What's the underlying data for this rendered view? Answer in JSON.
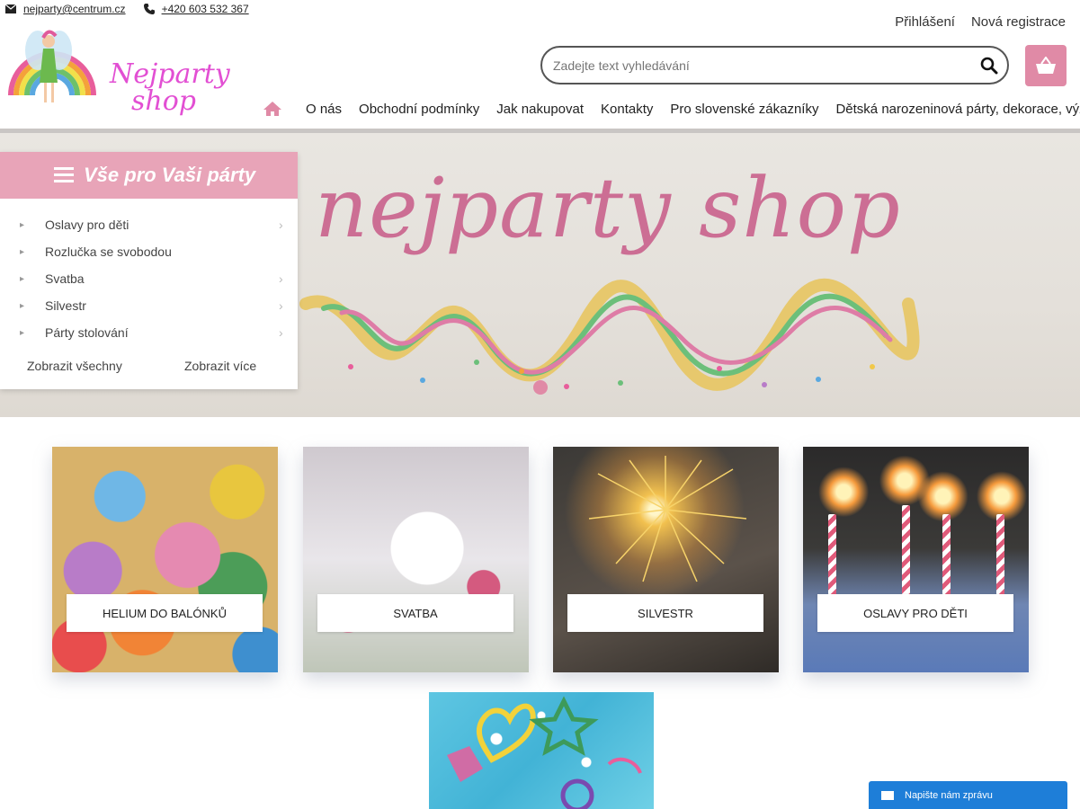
{
  "contact": {
    "email": "nejparty@centrum.cz",
    "phone": "+420 603 532 367"
  },
  "account": {
    "login": "Přihlášení",
    "register": "Nová registrace"
  },
  "logo": {
    "line1": "Nejparty",
    "line2": "shop"
  },
  "search": {
    "placeholder": "Zadejte text vyhledávání"
  },
  "nav": {
    "items": [
      "O nás",
      "Obchodní podmínky",
      "Jak nakupovat",
      "Kontakty",
      "Pro slovenské zákazníky",
      "Dětská narozeninová párty, dekorace, výzdoba"
    ]
  },
  "hero": {
    "title": "nejparty shop"
  },
  "sidemenu": {
    "title": "Vše pro Vaši párty",
    "items": [
      "Oslavy pro děti",
      "Rozlučka se svobodou",
      "Svatba",
      "Silvestr",
      "Párty stolování"
    ],
    "show_all": "Zobrazit všechny",
    "show_more": "Zobrazit více"
  },
  "categories": [
    "Helium do balónků",
    "Svatba",
    "Silvestr",
    "Oslavy pro děti"
  ],
  "chat": {
    "label": "Napište nám zprávu"
  },
  "colors": {
    "accent_pink": "#e08aa6",
    "menu_pink": "#e8a4b8",
    "chat_blue": "#1e7ed8"
  }
}
